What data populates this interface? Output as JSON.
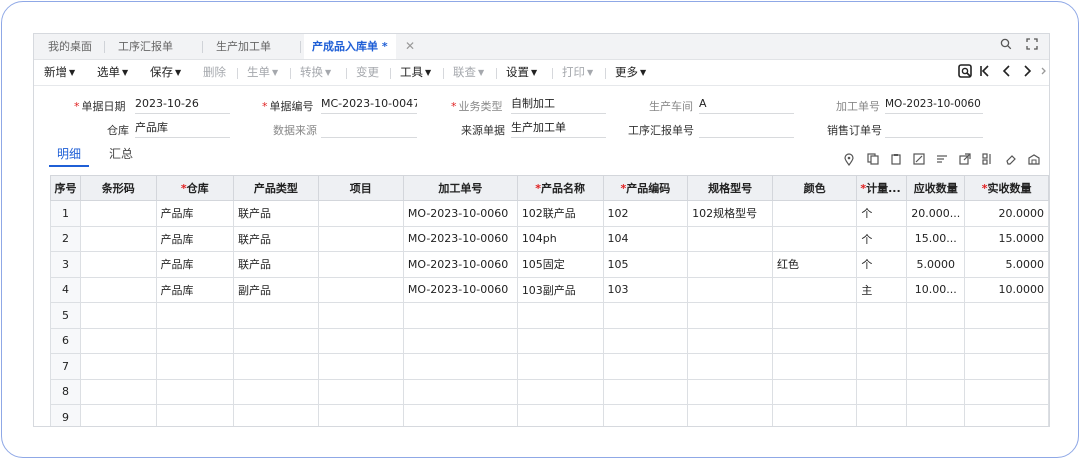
{
  "tabs": [
    {
      "label": "我的桌面"
    },
    {
      "label": "工序汇报单"
    },
    {
      "label": "生产加工单"
    },
    {
      "label": "产成品入库单 *"
    }
  ],
  "tab_close": "✕",
  "toolbar": {
    "add": "新增",
    "select": "选单",
    "save": "保存",
    "delete": "删除",
    "gen": "生单",
    "convert": "转换",
    "change": "变更",
    "tools": "工具",
    "audit": "联查",
    "settings": "设置",
    "print": "打印",
    "more": "更多"
  },
  "form": {
    "doc_date_label": "单据日期",
    "doc_date": "2023-10-26",
    "doc_no_label": "单据编号",
    "doc_no": "MC-2023-10-0047",
    "biz_type_label": "业务类型",
    "biz_type": "自制加工",
    "workshop_label": "生产车间",
    "workshop": "A",
    "order_no_label": "加工单号",
    "order_no": "MO-2023-10-0060",
    "warehouse_label": "仓库",
    "warehouse": "产品库",
    "data_source_label": "数据来源",
    "data_source": "",
    "source_doc_label": "来源单据",
    "source_doc": "生产加工单",
    "process_report_label": "工序汇报单号",
    "process_report": "",
    "sales_order_label": "销售订单号",
    "sales_order": ""
  },
  "subtabs": {
    "detail": "明细",
    "summary": "汇总"
  },
  "grid": {
    "headers": {
      "seq": "序号",
      "barcode": "条形码",
      "warehouse": "仓库",
      "prod_type": "产品类型",
      "project": "项目",
      "order_no": "加工单号",
      "prod_name": "产品名称",
      "prod_code": "产品编码",
      "spec": "规格型号",
      "color": "颜色",
      "unit": "计量...",
      "due_qty": "应收数量",
      "act_qty": "实收数量"
    },
    "rows": [
      {
        "seq": "1",
        "barcode": "",
        "warehouse": "产品库",
        "prod_type": "联产品",
        "project": "",
        "order_no": "MO-2023-10-0060",
        "prod_name": "102联产品",
        "prod_code": "102",
        "spec": "102规格型号",
        "color": "",
        "unit": "个",
        "due_qty": "20.000...",
        "act_qty": "20.0000"
      },
      {
        "seq": "2",
        "barcode": "",
        "warehouse": "产品库",
        "prod_type": "联产品",
        "project": "",
        "order_no": "MO-2023-10-0060",
        "prod_name": "104ph",
        "prod_code": "104",
        "spec": "",
        "color": "",
        "unit": "个",
        "due_qty": "15.00...",
        "act_qty": "15.0000"
      },
      {
        "seq": "3",
        "barcode": "",
        "warehouse": "产品库",
        "prod_type": "联产品",
        "project": "",
        "order_no": "MO-2023-10-0060",
        "prod_name": "105固定",
        "prod_code": "105",
        "spec": "",
        "color": "红色",
        "unit": "个",
        "due_qty": "5.0000",
        "act_qty": "5.0000"
      },
      {
        "seq": "4",
        "barcode": "",
        "warehouse": "产品库",
        "prod_type": "副产品",
        "project": "",
        "order_no": "MO-2023-10-0060",
        "prod_name": "103副产品",
        "prod_code": "103",
        "spec": "",
        "color": "",
        "unit": "主",
        "due_qty": "10.00...",
        "act_qty": "10.0000"
      },
      {
        "seq": "5",
        "barcode": "",
        "warehouse": "",
        "prod_type": "",
        "project": "",
        "order_no": "",
        "prod_name": "",
        "prod_code": "",
        "spec": "",
        "color": "",
        "unit": "",
        "due_qty": "",
        "act_qty": ""
      },
      {
        "seq": "6",
        "barcode": "",
        "warehouse": "",
        "prod_type": "",
        "project": "",
        "order_no": "",
        "prod_name": "",
        "prod_code": "",
        "spec": "",
        "color": "",
        "unit": "",
        "due_qty": "",
        "act_qty": ""
      },
      {
        "seq": "7",
        "barcode": "",
        "warehouse": "",
        "prod_type": "",
        "project": "",
        "order_no": "",
        "prod_name": "",
        "prod_code": "",
        "spec": "",
        "color": "",
        "unit": "",
        "due_qty": "",
        "act_qty": ""
      },
      {
        "seq": "8",
        "barcode": "",
        "warehouse": "",
        "prod_type": "",
        "project": "",
        "order_no": "",
        "prod_name": "",
        "prod_code": "",
        "spec": "",
        "color": "",
        "unit": "",
        "due_qty": "",
        "act_qty": ""
      },
      {
        "seq": "9",
        "barcode": "",
        "warehouse": "",
        "prod_type": "",
        "project": "",
        "order_no": "",
        "prod_name": "",
        "prod_code": "",
        "spec": "",
        "color": "",
        "unit": "",
        "due_qty": "",
        "act_qty": ""
      }
    ]
  },
  "colors": {
    "accent": "#1f5fd6",
    "required": "#e02020",
    "frame": "#8fa8e6"
  }
}
